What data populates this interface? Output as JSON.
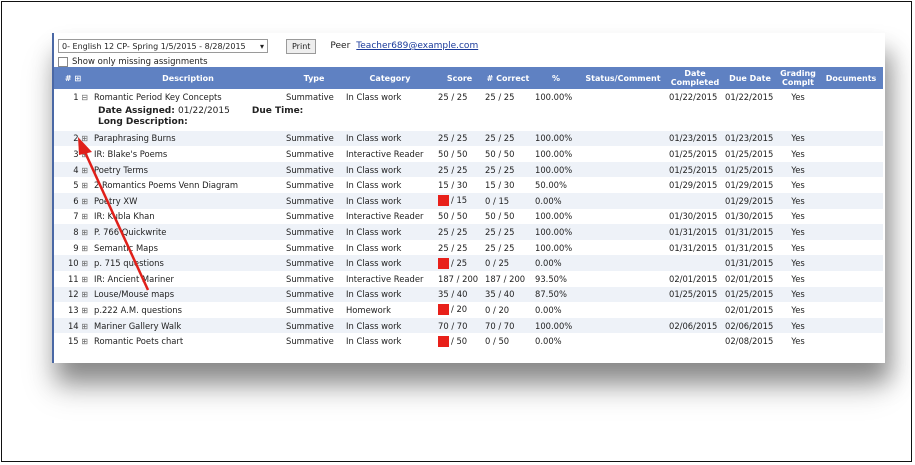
{
  "toolbar": {
    "class_select_value": "0- English 12 CP- Spring 1/5/2015 - 8/28/2015",
    "print_label": "Print",
    "peer_label": "Peer",
    "peer_email": "Teacher689@example.com",
    "missing_label": "Show only missing assignments"
  },
  "table": {
    "headers": [
      "#",
      "Description",
      "Type",
      "Category",
      "Score",
      "# Correct",
      "%",
      "Status/Comment",
      "Date Completed",
      "Due Date",
      "Grading Complt",
      "Documents"
    ],
    "header_num_symbol": "⊞",
    "expanded": {
      "date_assigned_label": "Date Assigned:",
      "date_assigned": "01/22/2015",
      "due_time_label": "Due Time:",
      "long_desc_label": "Long Description:"
    },
    "rows": [
      {
        "n": "1",
        "exp": "⊟",
        "desc": "Romantic Period Key Concepts",
        "type": "Summative",
        "cat": "In Class work",
        "missing": false,
        "score": "25 / 25",
        "correct": "25 / 25",
        "pct": "100.00%",
        "completed": "01/22/2015",
        "due": "01/22/2015",
        "graded": "Yes"
      },
      {
        "n": "2",
        "exp": "⊞",
        "desc": "Paraphrasing Burns",
        "type": "Summative",
        "cat": "In Class work",
        "missing": false,
        "score": "25 / 25",
        "correct": "25 / 25",
        "pct": "100.00%",
        "completed": "01/23/2015",
        "due": "01/23/2015",
        "graded": "Yes"
      },
      {
        "n": "3",
        "exp": "⊞",
        "desc": "IR: Blake's Poems",
        "type": "Summative",
        "cat": "Interactive Reader",
        "missing": false,
        "score": "50 / 50",
        "correct": "50 / 50",
        "pct": "100.00%",
        "completed": "01/25/2015",
        "due": "01/25/2015",
        "graded": "Yes"
      },
      {
        "n": "4",
        "exp": "⊞",
        "desc": "Poetry Terms",
        "type": "Summative",
        "cat": "In Class work",
        "missing": false,
        "score": "25 / 25",
        "correct": "25 / 25",
        "pct": "100.00%",
        "completed": "01/25/2015",
        "due": "01/25/2015",
        "graded": "Yes"
      },
      {
        "n": "5",
        "exp": "⊞",
        "desc": "2 Romantics Poems Venn Diagram",
        "type": "Summative",
        "cat": "In Class work",
        "missing": false,
        "score": "15 / 30",
        "correct": "15 / 30",
        "pct": "50.00%",
        "completed": "01/29/2015",
        "due": "01/29/2015",
        "graded": "Yes"
      },
      {
        "n": "6",
        "exp": "⊞",
        "desc": "Poetry XW",
        "type": "Summative",
        "cat": "In Class work",
        "missing": true,
        "score": "/ 15",
        "correct": "0 / 15",
        "pct": "0.00%",
        "completed": "",
        "due": "01/29/2015",
        "graded": "Yes"
      },
      {
        "n": "7",
        "exp": "⊞",
        "desc": "IR: Kubla Khan",
        "type": "Summative",
        "cat": "Interactive Reader",
        "missing": false,
        "score": "50 / 50",
        "correct": "50 / 50",
        "pct": "100.00%",
        "completed": "01/30/2015",
        "due": "01/30/2015",
        "graded": "Yes"
      },
      {
        "n": "8",
        "exp": "⊞",
        "desc": "P. 766 Quickwrite",
        "type": "Summative",
        "cat": "In Class work",
        "missing": false,
        "score": "25 / 25",
        "correct": "25 / 25",
        "pct": "100.00%",
        "completed": "01/31/2015",
        "due": "01/31/2015",
        "graded": "Yes"
      },
      {
        "n": "9",
        "exp": "⊞",
        "desc": "Semantic Maps",
        "type": "Summative",
        "cat": "In Class work",
        "missing": false,
        "score": "25 / 25",
        "correct": "25 / 25",
        "pct": "100.00%",
        "completed": "01/31/2015",
        "due": "01/31/2015",
        "graded": "Yes"
      },
      {
        "n": "10",
        "exp": "⊞",
        "desc": "p. 715 questions",
        "type": "Summative",
        "cat": "In Class work",
        "missing": true,
        "score": "/ 25",
        "correct": "0 / 25",
        "pct": "0.00%",
        "completed": "",
        "due": "01/31/2015",
        "graded": "Yes"
      },
      {
        "n": "11",
        "exp": "⊞",
        "desc": "IR: Ancient Mariner",
        "type": "Summative",
        "cat": "Interactive Reader",
        "missing": false,
        "score": "187 / 200",
        "correct": "187 / 200",
        "pct": "93.50%",
        "completed": "02/01/2015",
        "due": "02/01/2015",
        "graded": "Yes"
      },
      {
        "n": "12",
        "exp": "⊞",
        "desc": "Louse/Mouse maps",
        "type": "Summative",
        "cat": "In Class work",
        "missing": false,
        "score": "35 / 40",
        "correct": "35 / 40",
        "pct": "87.50%",
        "completed": "01/25/2015",
        "due": "01/25/2015",
        "graded": "Yes"
      },
      {
        "n": "13",
        "exp": "⊞",
        "desc": "p.222 A.M. questions",
        "type": "Summative",
        "cat": "Homework",
        "missing": true,
        "score": "/ 20",
        "correct": "0 / 20",
        "pct": "0.00%",
        "completed": "",
        "due": "02/01/2015",
        "graded": "Yes"
      },
      {
        "n": "14",
        "exp": "⊞",
        "desc": "Mariner Gallery Walk",
        "type": "Summative",
        "cat": "In Class work",
        "missing": false,
        "score": "70 / 70",
        "correct": "70 / 70",
        "pct": "100.00%",
        "completed": "02/06/2015",
        "due": "02/06/2015",
        "graded": "Yes"
      },
      {
        "n": "15",
        "exp": "⊞",
        "desc": "Romantic Poets chart",
        "type": "Summative",
        "cat": "In Class work",
        "missing": true,
        "score": "/ 50",
        "correct": "0 / 50",
        "pct": "0.00%",
        "completed": "",
        "due": "02/08/2015",
        "graded": "Yes"
      }
    ]
  },
  "colors": {
    "header_bg": "#5f81c2",
    "row_alt_bg": "#eef2f8",
    "missing_marker": "#e8201a",
    "annotation_arrow": "#e0201a"
  }
}
